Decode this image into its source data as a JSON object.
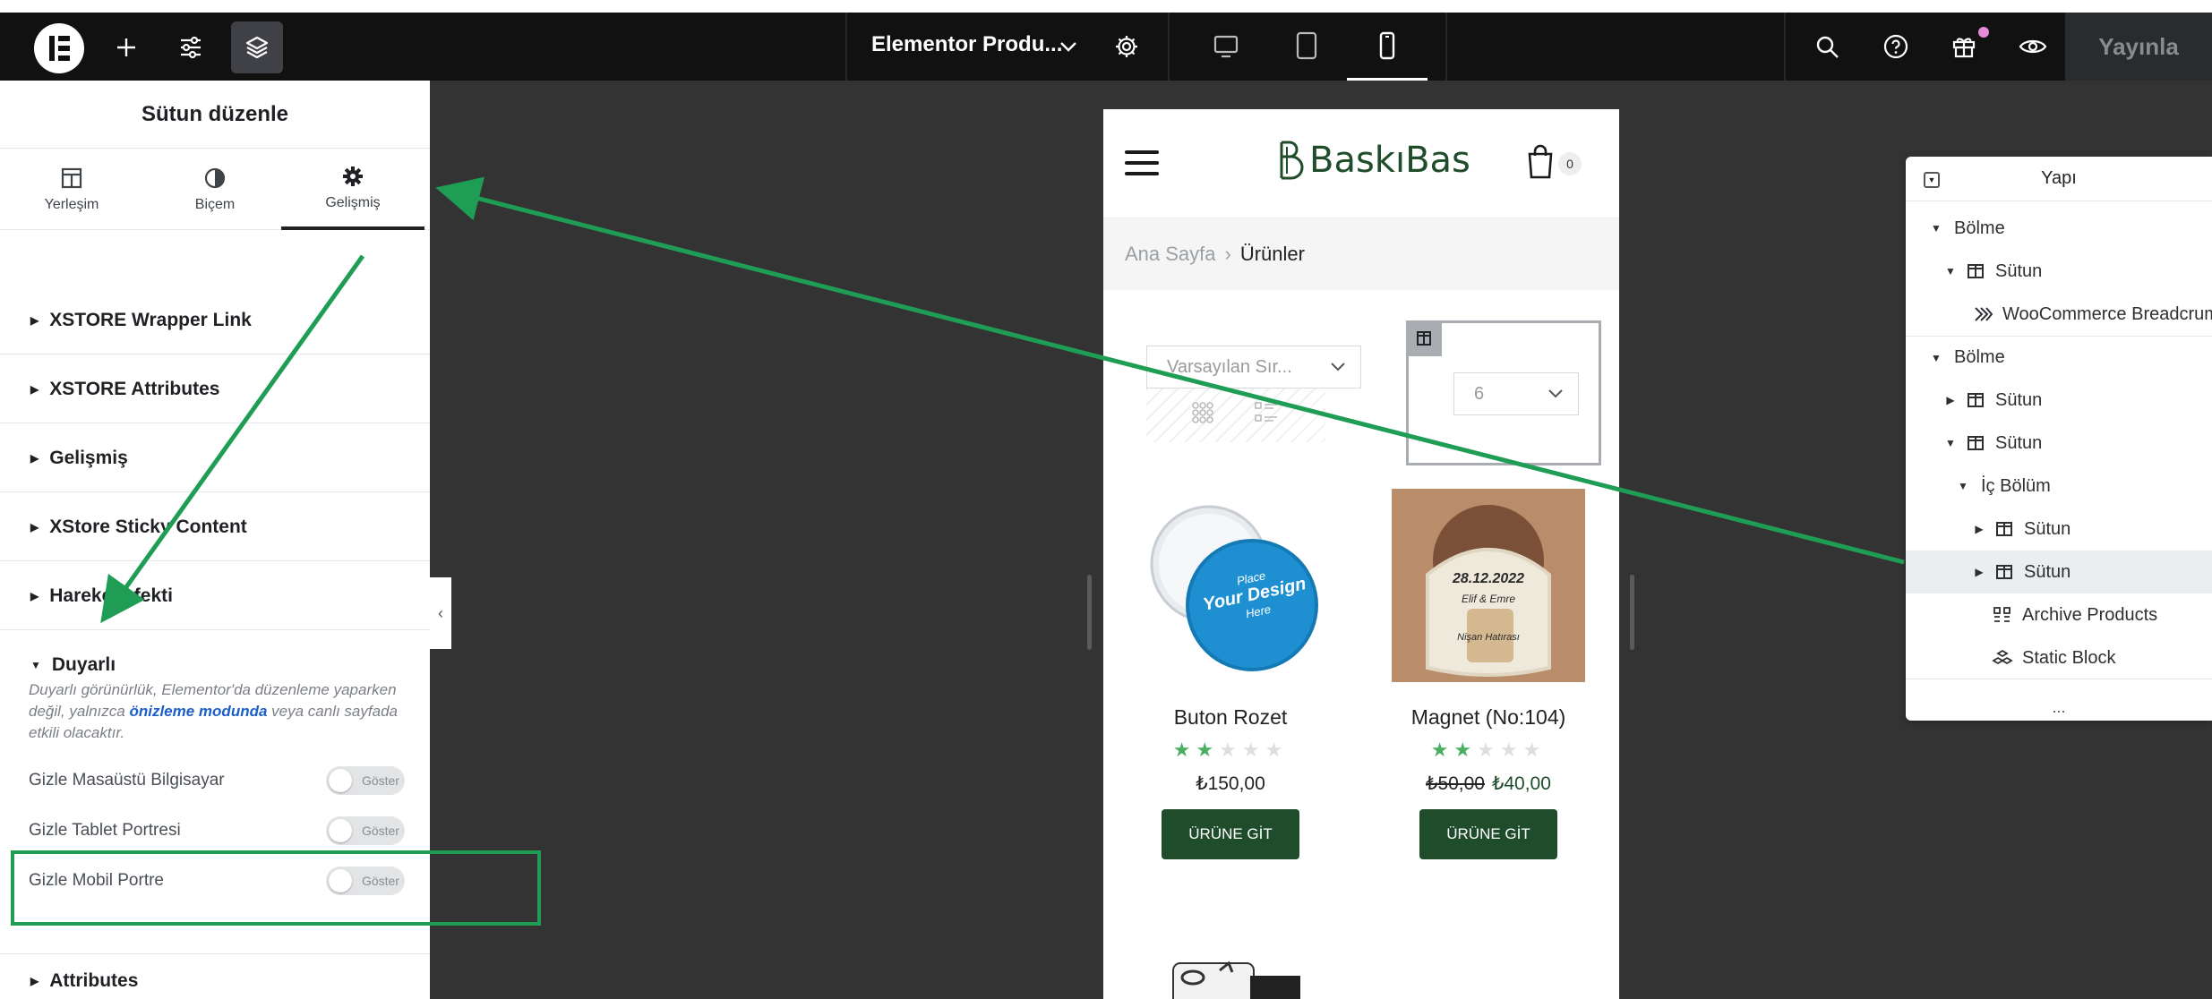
{
  "topbar": {
    "document_title": "Elementor Produ...",
    "publish_label": "Yayınla",
    "icons": [
      "elementor-logo",
      "plus-icon",
      "sliders-icon",
      "layers-icon",
      "chevron-down-icon",
      "gear-icon",
      "desktop-icon",
      "tablet-icon",
      "mobile-icon",
      "search-icon",
      "help-icon",
      "gift-icon",
      "eye-icon"
    ]
  },
  "panel": {
    "title": "Sütun düzenle",
    "tabs": [
      {
        "label": "Yerleşim",
        "icon": "layout-icon"
      },
      {
        "label": "Biçem",
        "icon": "contrast-icon"
      },
      {
        "label": "Gelişmiş",
        "icon": "gear-icon",
        "active": true
      }
    ],
    "sections": [
      {
        "label": "XSTORE Wrapper Link"
      },
      {
        "label": "XSTORE Attributes"
      },
      {
        "label": "Gelişmiş"
      },
      {
        "label": "XStore Sticky Content"
      },
      {
        "label": "Hareket efekti"
      },
      {
        "label": "Duyarlı",
        "open": true
      },
      {
        "label": "Attributes"
      }
    ],
    "responsive_note": {
      "before": "Duyarlı görünürlük, Elementor'da düzenleme yaparken değil, yalnızca",
      "link": "önizleme modunda",
      "after": "veya canlı sayfada etkili olacaktır."
    },
    "controls": [
      {
        "label": "Gizle Masaüstü Bilgisayar",
        "toggle": "Göster"
      },
      {
        "label": "Gizle Tablet Portresi",
        "toggle": "Göster"
      },
      {
        "label": "Gizle Mobil Portre",
        "toggle": "Göster"
      }
    ]
  },
  "preview": {
    "brand": "BaskıBas",
    "cart_count": "0",
    "breadcrumb": {
      "home": "Ana Sayfa",
      "separator": "›",
      "current": "Ürünler"
    },
    "sort_placeholder": "Varsayılan Sır...",
    "per_page": "6",
    "products": [
      {
        "name": "Buton Rozet",
        "rating": 2,
        "old_price": "",
        "price": "₺150,00",
        "button": "ÜRÜNE GİT",
        "image_text": {
          "a": "Place",
          "b": "Your Design",
          "c": "Here"
        }
      },
      {
        "name": "Magnet (No:104)",
        "rating": 2,
        "old_price": "₺50,00",
        "price": "₺40,00",
        "button": "ÜRÜNE GİT",
        "image_text": {
          "a": "28.12.2022",
          "b": "Elif & Emre",
          "c": "Nişan Hatırası"
        }
      }
    ]
  },
  "structure": {
    "title": "Yapı",
    "nodes": [
      {
        "label": "Bölme",
        "caret": "down",
        "icon": "",
        "depth": 0
      },
      {
        "label": "Sütun",
        "caret": "down",
        "icon": "column-icon",
        "depth": 1
      },
      {
        "label": "WooCommerce Breadcrumb",
        "caret": "",
        "icon": "breadcrumb-icon",
        "depth": 2
      },
      {
        "label": "Bölme",
        "caret": "down",
        "icon": "",
        "depth": 0
      },
      {
        "label": "Sütun",
        "caret": "right",
        "icon": "column-icon",
        "depth": 1
      },
      {
        "label": "Sütun",
        "caret": "down",
        "icon": "column-icon",
        "depth": 1
      },
      {
        "label": "İç Bölüm",
        "caret": "down",
        "icon": "",
        "depth": 2
      },
      {
        "label": "Sütun",
        "caret": "right",
        "icon": "column-icon",
        "depth": 3
      },
      {
        "label": "Sütun",
        "caret": "right",
        "icon": "column-icon",
        "depth": 3,
        "selected": true
      },
      {
        "label": "Archive Products",
        "caret": "",
        "icon": "products-icon",
        "depth": 2
      },
      {
        "label": "Static Block",
        "caret": "",
        "icon": "blocks-icon",
        "depth": 2
      }
    ],
    "footer": "..."
  },
  "colors": {
    "topbar": "#111111",
    "canvas": "#333333",
    "brand_green": "#1f4d2b",
    "star_green": "#4cae62",
    "annotation_green": "#1f9d55",
    "link_blue": "#1c5fc9"
  }
}
